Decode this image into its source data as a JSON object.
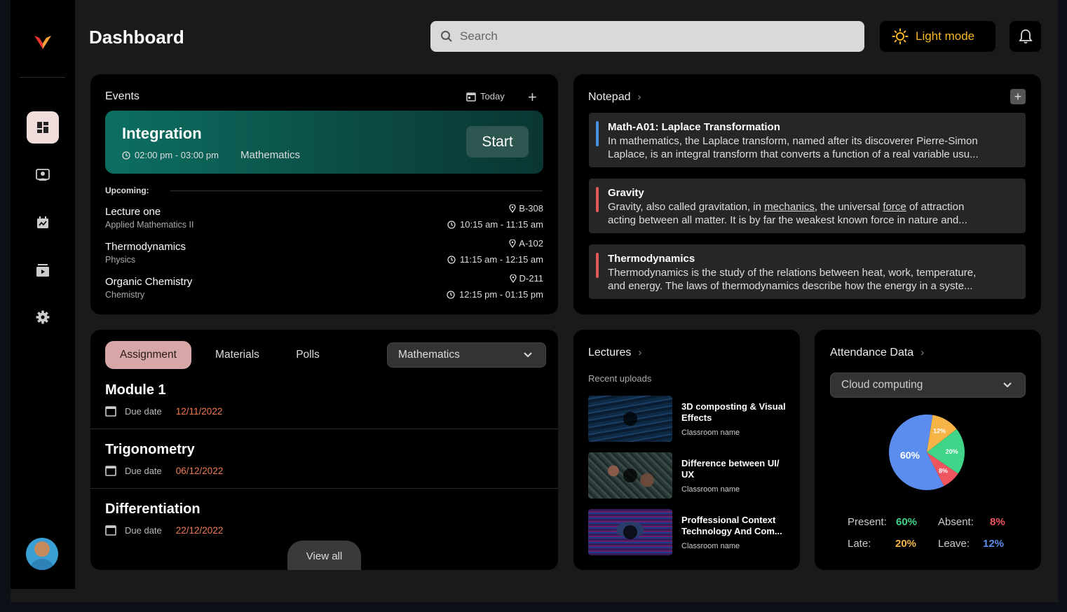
{
  "header": {
    "title": "Dashboard",
    "search_placeholder": "Search",
    "theme_toggle_label": "Light mode"
  },
  "sidebar": {
    "items": [
      {
        "icon": "dashboard-icon",
        "active": true
      },
      {
        "icon": "people-icon"
      },
      {
        "icon": "calendar-icon"
      },
      {
        "icon": "media-icon"
      },
      {
        "icon": "gear-icon"
      }
    ]
  },
  "events": {
    "title": "Events",
    "filter_label": "Today",
    "current": {
      "title": "Integration",
      "time": "02:00 pm - 03:00 pm",
      "subject": "Mathematics",
      "action_label": "Start"
    },
    "upcoming_label": "Upcoming:",
    "upcoming": [
      {
        "name": "Lecture one",
        "subject": "Applied Mathematics II",
        "room": "B-308",
        "time": "10:15 am - 11:15 am"
      },
      {
        "name": "Thermodynamics",
        "subject": "Physics",
        "room": "A-102",
        "time": "11:15 am - 12:15 am"
      },
      {
        "name": "Organic Chemistry",
        "subject": "Chemistry",
        "room": "D-211",
        "time": "12:15 pm - 01:15 pm"
      }
    ]
  },
  "notepad": {
    "title": "Notepad",
    "notes": [
      {
        "title": "Math-A01: Laplace Transformation",
        "line1": "In mathematics, the Laplace transform, named after its discoverer Pierre-Simon",
        "line2": "Laplace, is an integral transform that converts a function of a real variable usu...",
        "color": "#4a90e2"
      },
      {
        "title": "Gravity",
        "line1_a": "Gravity, also called gravitation, in ",
        "line1_link1": "mechanics",
        "line1_b": ", the universal ",
        "line1_link2": "force",
        "line1_c": " of attraction",
        "line2": "acting between all matter. It is by far the weakest known force in nature and...",
        "color": "#e05a5a"
      },
      {
        "title": "Thermodynamics",
        "line1": "Thermodynamics is the study of the relations between heat, work, temperature,",
        "line2": "and energy. The laws of thermodynamics describe how the energy in a syste...",
        "color": "#e05a5a"
      }
    ]
  },
  "assignments": {
    "tabs": [
      "Assignment",
      "Materials",
      "Polls"
    ],
    "subject_selected": "Mathematics",
    "due_label": "Due date",
    "items": [
      {
        "title": "Module 1",
        "due": "12/11/2022"
      },
      {
        "title": "Trigonometry",
        "due": "06/12/2022"
      },
      {
        "title": "Differentiation",
        "due": "22/12/2022"
      }
    ],
    "view_all_label": "View all"
  },
  "lectures": {
    "title": "Lectures",
    "subtitle": "Recent uploads",
    "items": [
      {
        "title": "3D composting & Visual Effects",
        "classroom": "Classroom name"
      },
      {
        "title": "Difference between UI/ UX",
        "classroom": "Classroom name"
      },
      {
        "title": "Proffessional Context Technology And Com...",
        "classroom": "Classroom name"
      }
    ]
  },
  "attendance": {
    "title": "Attendance Data",
    "course_selected": "Cloud computing",
    "present_label": "Present:",
    "absent_label": "Absent:",
    "late_label": "Late:",
    "leave_label": "Leave:",
    "present_value": "60%",
    "absent_value": "8%",
    "late_value": "20%",
    "leave_value": "12%",
    "pie_labels": {
      "present": "60%",
      "leave": "12%",
      "late": "20%",
      "absent": "8%"
    },
    "colors": {
      "present": "#5b8def",
      "leave": "#f5b445",
      "late": "#3fd488",
      "absent": "#f0545e"
    }
  },
  "chart_data": {
    "type": "pie",
    "categories": [
      "Present",
      "Leave",
      "Late",
      "Absent"
    ],
    "values": [
      60,
      12,
      20,
      8
    ]
  }
}
